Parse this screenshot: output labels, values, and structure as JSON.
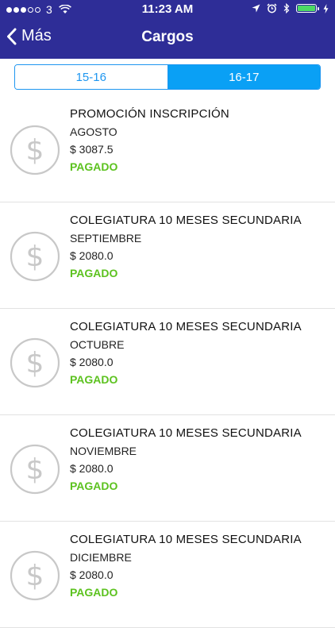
{
  "status_bar": {
    "carrier": "3",
    "time": "11:23 AM"
  },
  "nav": {
    "back_label": "Más",
    "title": "Cargos"
  },
  "segments": [
    {
      "label": "15-16",
      "selected": false
    },
    {
      "label": "16-17",
      "selected": true
    }
  ],
  "charges": [
    {
      "concept": "PROMOCIÓN INSCRIPCIÓN",
      "month": "AGOSTO",
      "amount": "$ 3087.5",
      "status": "PAGADO"
    },
    {
      "concept": "COLEGIATURA 10 MESES SECUNDARIA",
      "month": "SEPTIEMBRE",
      "amount": "$ 2080.0",
      "status": "PAGADO"
    },
    {
      "concept": "COLEGIATURA 10 MESES SECUNDARIA",
      "month": "OCTUBRE",
      "amount": "$ 2080.0",
      "status": "PAGADO"
    },
    {
      "concept": "COLEGIATURA 10 MESES SECUNDARIA",
      "month": "NOVIEMBRE",
      "amount": "$ 2080.0",
      "status": "PAGADO"
    },
    {
      "concept": "COLEGIATURA 10 MESES SECUNDARIA",
      "month": "DICIEMBRE",
      "amount": "$ 2080.0",
      "status": "PAGADO"
    }
  ],
  "colors": {
    "nav_background": "#2e2d97",
    "accent_blue": "#0aa0f5",
    "paid_green": "#5cc21f",
    "icon_gray": "#c8c8c8"
  },
  "icons": {
    "charge_icon": "dollar-coin-icon",
    "back_icon": "chevron-left-icon"
  }
}
